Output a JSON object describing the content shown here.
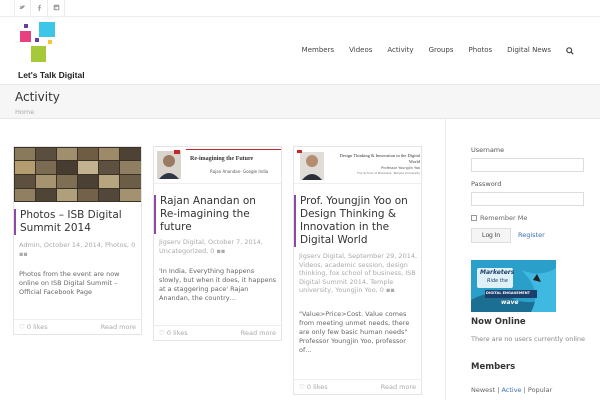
{
  "social": [
    "twitter-icon",
    "facebook-icon",
    "linkedin-icon"
  ],
  "brand": {
    "name": "Let's Talk Digital",
    "colors": {
      "pink": "#e8417f",
      "cyan": "#3dc6e8",
      "green": "#a6c93a",
      "purple": "#6a3e9c"
    }
  },
  "nav": {
    "items": [
      "Members",
      "Videos",
      "Activity",
      "Groups",
      "Photos",
      "Digital News"
    ]
  },
  "page": {
    "title": "Activity",
    "breadcrumb": "Home"
  },
  "accent": "#8c4ba0",
  "cards": [
    {
      "title": "Photos – ISB Digital Summit 2014",
      "meta": "Admin, October 14, 2014, Photos, 0",
      "excerpt": "Photos from the event are now online on ISB Digital Summit – Official Facebook Page",
      "likes": "0 likes",
      "readmore": "Read more"
    },
    {
      "title": "Rajan Anandan on Re-imagining the future",
      "thumb_title": "Re-imagining the Future",
      "thumb_caption": "Rajan Anandan- Google India",
      "meta": "Jigserv Digital, October 7, 2014, Uncategorized, 0",
      "excerpt": "'In India, Everything happens slowly, but when it does, it happens at a staggering pace' Rajan Anandan, the country…",
      "likes": "0 likes",
      "readmore": "Read more"
    },
    {
      "title": "Prof. Youngjin Yoo on Design Thinking & Innovation in the Digital World",
      "thumb_title": "Design Thinking & Innovation in the Digital World",
      "thumb_caption": "Professor Youngjin Yoo",
      "thumb_sub": "Fox School of Business, Temple University",
      "meta": "Jigserv Digital, September 29, 2014, Videos, academic session, design thinking, fox school of business, ISB Digital Summit 2014, Temple university, Youngjin Yoo, 0",
      "excerpt": "\"Value>Price>Cost. Value comes from meeting unmet needs, there are only few basic human needs\" Professor Youngjin Yoo, professor of…",
      "likes": "0 likes",
      "readmore": "Read more"
    }
  ],
  "sidebar": {
    "username_label": "Username",
    "password_label": "Password",
    "remember_label": "Remember Me",
    "login_label": "Log In",
    "register_label": "Register",
    "banner": {
      "line1": "Marketers",
      "line2": "Ride the",
      "line3": "DIGITAL ENGAGEMENT",
      "line4": "wave"
    },
    "now_online_heading": "Now Online",
    "now_online_text": "There are no users currently online",
    "members_heading": "Members",
    "members_filters": {
      "newest": "Newest",
      "active": "Active",
      "popular": "Popular"
    }
  }
}
